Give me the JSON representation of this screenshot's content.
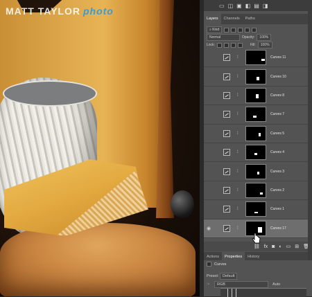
{
  "watermark": {
    "name": "MATT TAYLOR",
    "suffix": "photo"
  },
  "panel": {
    "tabs": [
      "Layers",
      "Channels",
      "Paths"
    ],
    "filter_kind": "Kind",
    "blend_mode": "Normal",
    "opacity_label": "Opacity:",
    "opacity_value": "100%",
    "lock_label": "Lock:",
    "fill_label": "Fill:",
    "fill_value": "100%",
    "layers": [
      {
        "name": "Curves 11",
        "visible": false,
        "selected": false
      },
      {
        "name": "Curves 10",
        "visible": false,
        "selected": false
      },
      {
        "name": "Curves 8",
        "visible": false,
        "selected": false
      },
      {
        "name": "Curves 7",
        "visible": false,
        "selected": false
      },
      {
        "name": "Curves 5",
        "visible": false,
        "selected": false
      },
      {
        "name": "Curves 4",
        "visible": false,
        "selected": false
      },
      {
        "name": "Curves 3",
        "visible": false,
        "selected": false
      },
      {
        "name": "Curves 2",
        "visible": false,
        "selected": false
      },
      {
        "name": "Curves 1",
        "visible": false,
        "selected": false
      },
      {
        "name": "Curves 17",
        "visible": true,
        "selected": true
      }
    ],
    "footer_icons": [
      "link-icon",
      "fx-icon",
      "mask-icon",
      "adjustment-icon",
      "group-icon",
      "new-layer-icon",
      "trash-icon"
    ],
    "footer_fx": "fx",
    "bottom_tabs": [
      "Actions",
      "Properties",
      "History"
    ],
    "properties_title": "Curves",
    "preset_label": "Preset:",
    "preset_value": "Default",
    "channel_value": "RGB",
    "auto_label": "Auto"
  }
}
